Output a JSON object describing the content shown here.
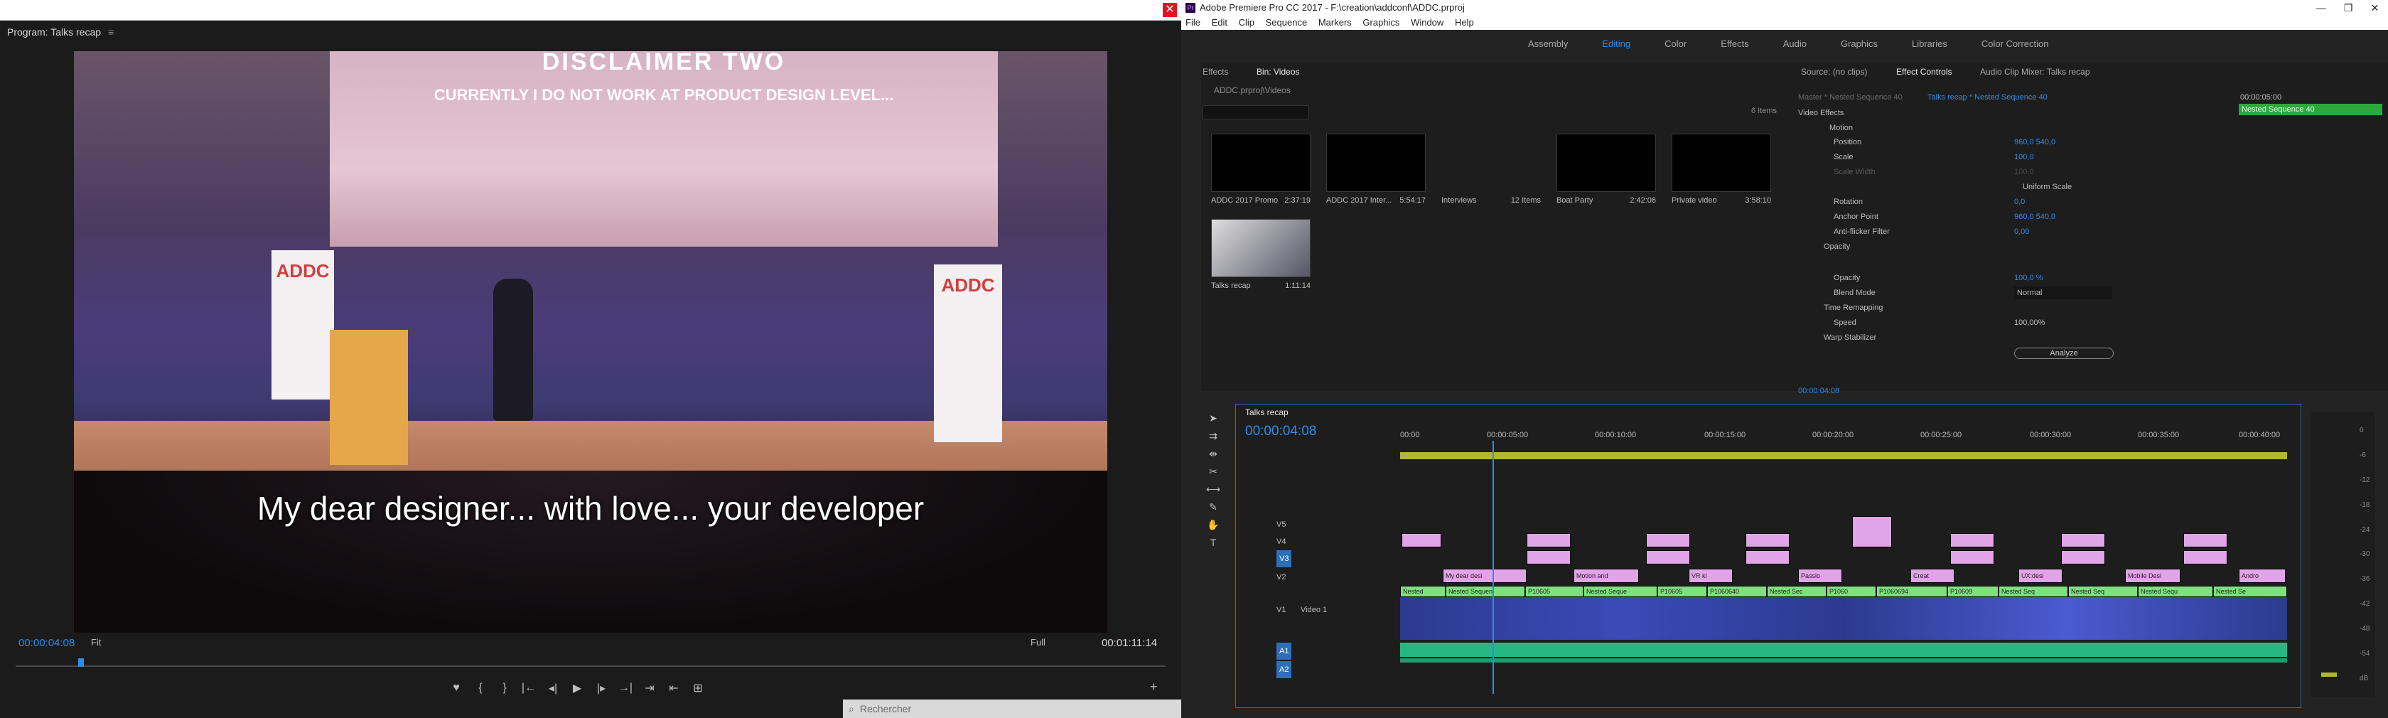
{
  "program_window": {
    "tab_title": "Program: Talks recap",
    "menu_icon": "≡",
    "close_glyph": "✕",
    "screen_line1": "DISCLAIMER TWO",
    "screen_line2": "CURRENTLY I DO NOT WORK AT PRODUCT DESIGN LEVEL...",
    "banner_text": "ADDC",
    "subtitle": "My dear designer... with love... your developer",
    "timecode_current": "00:00:04:08",
    "zoom": "Fit",
    "resolution": "Full",
    "timecode_duration": "00:01:11:14",
    "add_glyph": "+",
    "controls": [
      "♥",
      "{",
      "}",
      "|←",
      "◂|",
      "▶",
      "|▸",
      "→|",
      "⇥",
      "⇤",
      "⊞"
    ],
    "taskbar_text": "Rechercher"
  },
  "premiere": {
    "title": "Adobe Premiere Pro CC 2017 - F:\\creation\\addconf\\ADDC.prproj",
    "logo_text": "Pr",
    "window_controls": [
      "—",
      "❐",
      "✕"
    ],
    "menu": [
      "File",
      "Edit",
      "Clip",
      "Sequence",
      "Markers",
      "Graphics",
      "Window",
      "Help"
    ],
    "workspaces": [
      "Assembly",
      "Editing",
      "Color",
      "Effects",
      "Audio",
      "Graphics",
      "Libraries",
      "Color Correction"
    ],
    "active_workspace": "Editing",
    "project_panel": {
      "tabs": [
        "Effects",
        "Bin: Videos"
      ],
      "path": "ADDC.prproj\\Videos",
      "item_count": "6 Items",
      "clips": [
        {
          "name": "ADDC 2017 Promo",
          "duration": "2:37:19"
        },
        {
          "name": "ADDC 2017 Inter...",
          "duration": "5:54:17"
        },
        {
          "name": "Interviews",
          "duration": "12 Items"
        },
        {
          "name": "Boat Party",
          "duration": "2:42:06"
        },
        {
          "name": "Private video",
          "duration": "3:58:10"
        },
        {
          "name": "Talks recap",
          "duration": "1:11:14"
        }
      ]
    },
    "effect_controls": {
      "tabs": [
        "Source: (no clips)",
        "Effect Controls",
        "Audio Clip Mixer: Talks recap"
      ],
      "master": "Master * Nested Sequence 40",
      "sequence": "Talks recap * Nested Sequence 40",
      "timebar_label": "Nested Sequence 40",
      "ruler_time": "00:00:05:00",
      "section": "Video Effects",
      "rows": [
        {
          "label": "Motion",
          "value": ""
        },
        {
          "label": "Position",
          "value": "960,0     540,0"
        },
        {
          "label": "Scale",
          "value": "100,0"
        },
        {
          "label": "Scale Width",
          "value": "100,0"
        },
        {
          "label": "Uniform Scale",
          "value": ""
        },
        {
          "label": "Rotation",
          "value": "0,0"
        },
        {
          "label": "Anchor Point",
          "value": "960,0     540,0"
        },
        {
          "label": "Anti-flicker Filter",
          "value": "0,00"
        },
        {
          "label": "Opacity",
          "value": ""
        },
        {
          "label": "Opacity",
          "value": "100,0 %"
        },
        {
          "label": "Blend Mode",
          "value": "Normal"
        },
        {
          "label": "Time Remapping",
          "value": ""
        },
        {
          "label": "Speed",
          "value": "100,00%"
        },
        {
          "label": "Warp Stabilizer",
          "value": ""
        }
      ],
      "analyze_label": "Analyze",
      "timecode": "00:00:04:08"
    },
    "timeline": {
      "tab": "Talks recap",
      "timecode": "00:00:04:08",
      "ruler": [
        "00:00",
        "00:00:05:00",
        "00:00:10:00",
        "00:00:15:00",
        "00:00:20:00",
        "00:00:25:00",
        "00:00:30:00",
        "00:00:35:00",
        "00:00:40:00"
      ],
      "tracks": [
        "V5",
        "V4",
        "V3",
        "V2",
        "V1",
        "A1",
        "A2"
      ],
      "v1_name": "Video 1",
      "v2_clips": [
        "My dear desi",
        "Motion and",
        "VR ki",
        "Passio",
        "Creat",
        "UX:desi",
        "Mobile Desi",
        "Andro"
      ],
      "v1_clips": [
        "Nested",
        "Nested Sequen",
        "P10605",
        "Nested Seque",
        "P10605",
        "P1060640",
        "Nested Sec",
        "P1060",
        "P1060694",
        "P10609",
        "Nested Seq",
        "Nested Seq",
        "Nested Sequ",
        "Nested Se"
      ],
      "meter_scale": [
        "0",
        "-6",
        "-12",
        "-18",
        "-24",
        "-30",
        "-36",
        "-42",
        "-48",
        "-54",
        "dB"
      ]
    }
  }
}
